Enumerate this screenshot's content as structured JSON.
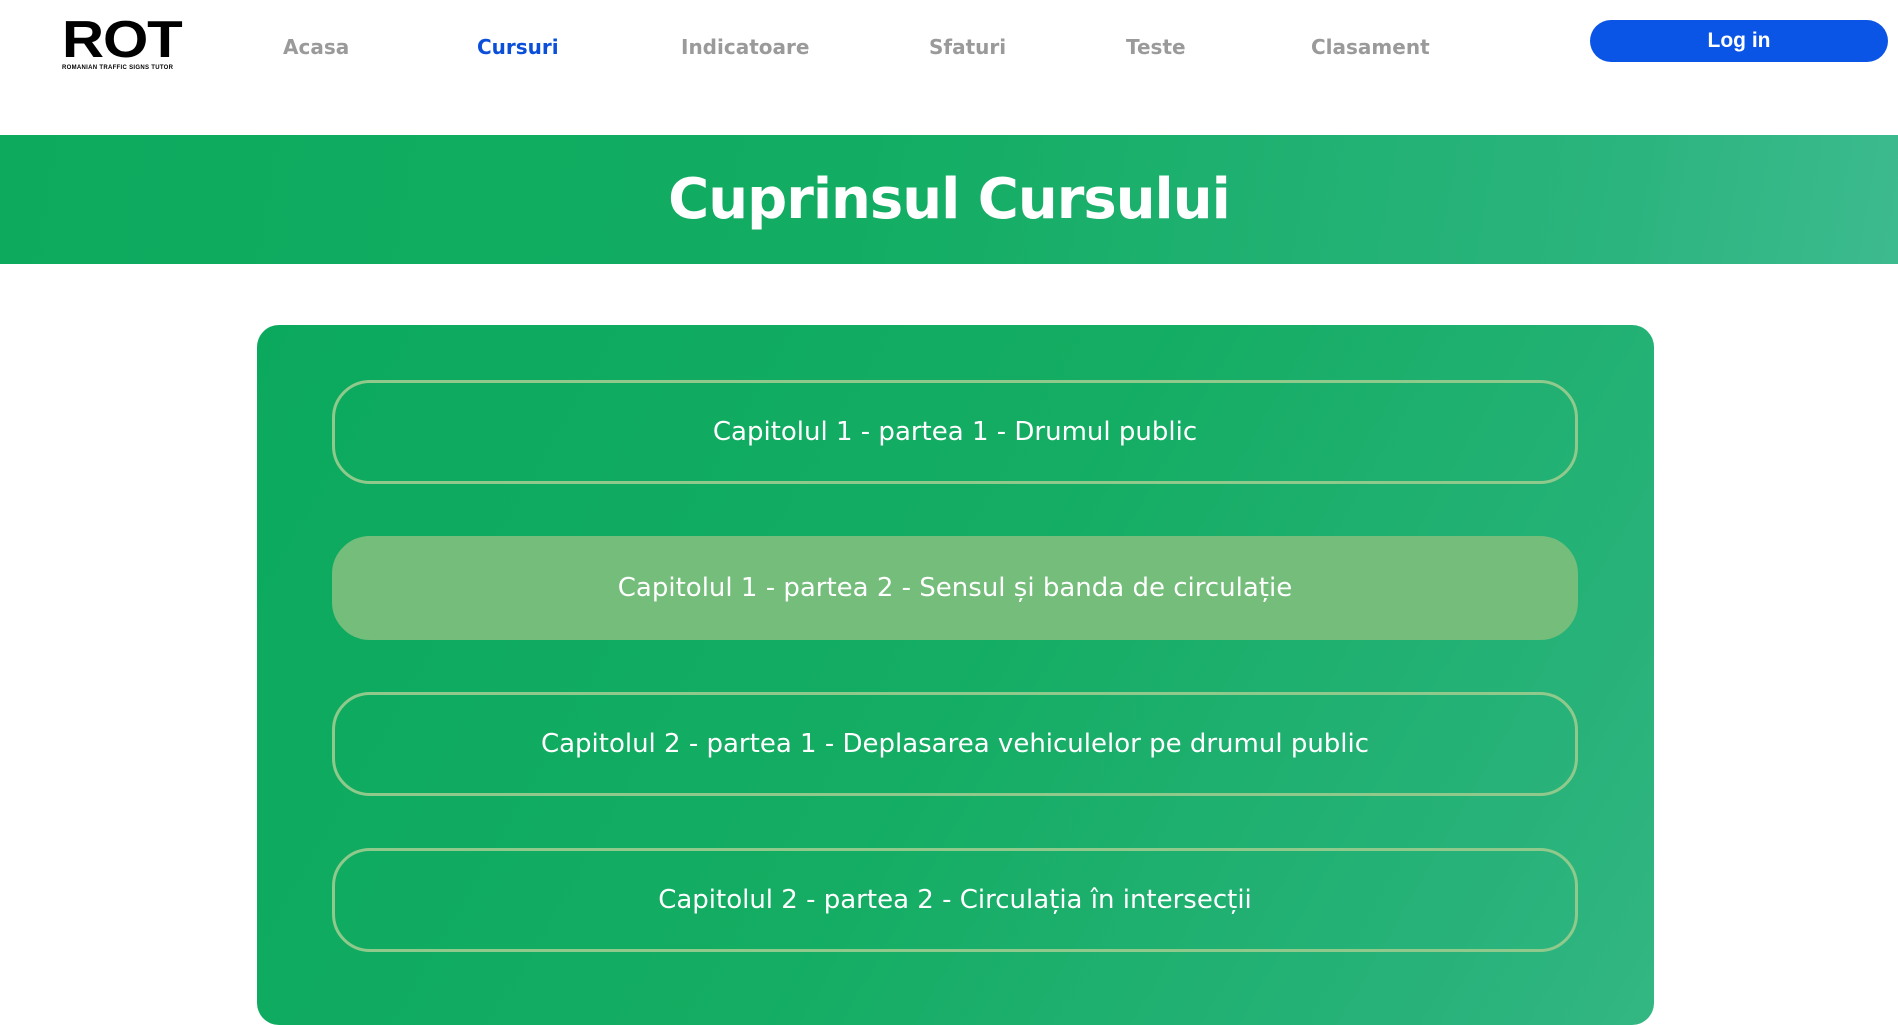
{
  "header": {
    "logo": {
      "mark": "ROT",
      "subtitle": "ROMANIAN TRAFFIC SIGNS TUTOR"
    },
    "nav": [
      {
        "label": "Acasa",
        "active": false
      },
      {
        "label": "Cursuri",
        "active": true
      },
      {
        "label": "Indicatoare",
        "active": false
      },
      {
        "label": "Sfaturi",
        "active": false
      },
      {
        "label": "Teste",
        "active": false
      },
      {
        "label": "Clasament",
        "active": false
      }
    ],
    "login_label": "Log in"
  },
  "banner": {
    "title": "Cuprinsul Cursului"
  },
  "chapters": [
    {
      "label": "Capitolul 1 - partea 1 - Drumul public",
      "active": false
    },
    {
      "label": "Capitolul 1 - partea 2 - Sensul și banda de circulație",
      "active": true
    },
    {
      "label": "Capitolul 2 - partea 1 - Deplasarea vehiculelor pe drumul public",
      "active": false
    },
    {
      "label": "Capitolul 2 - partea 2 - Circulația în intersecții",
      "active": false
    }
  ],
  "colors": {
    "accent_blue": "#0b55e6",
    "nav_active": "#0b4fd9",
    "nav_inactive": "#9a9a9a",
    "green": "#0daa5e",
    "chapter_active": "#74bd7b",
    "chapter_border": "#8fc98b"
  }
}
